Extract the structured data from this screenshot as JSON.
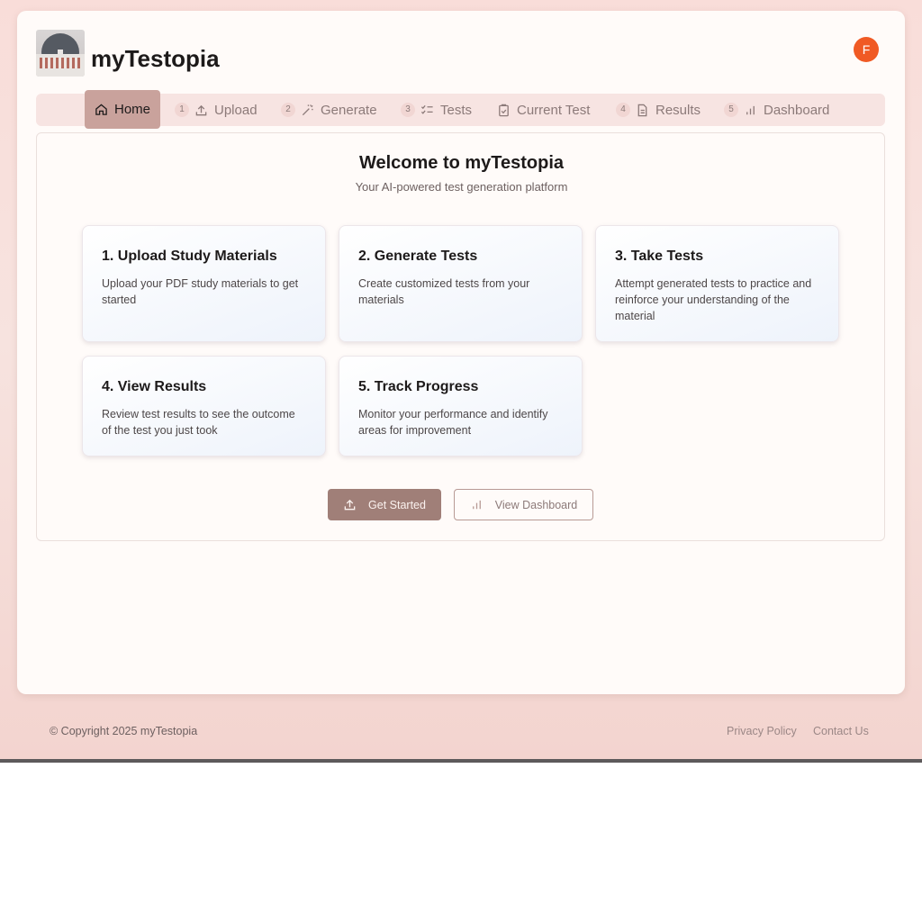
{
  "app": {
    "brand": "myTestopia",
    "avatar_initial": "F"
  },
  "nav": {
    "items": [
      {
        "label": "Home",
        "icon": "home-icon",
        "step": ""
      },
      {
        "label": "Upload",
        "icon": "upload-icon",
        "step": "1"
      },
      {
        "label": "Generate",
        "icon": "wand-icon",
        "step": "2"
      },
      {
        "label": "Tests",
        "icon": "checklist-icon",
        "step": "3"
      },
      {
        "label": "Current Test",
        "icon": "clipboard-icon",
        "step": ""
      },
      {
        "label": "Results",
        "icon": "document-icon",
        "step": "4"
      },
      {
        "label": "Dashboard",
        "icon": "bar-chart-icon",
        "step": "5"
      }
    ],
    "active": "Home"
  },
  "main": {
    "title": "Welcome to myTestopia",
    "subtitle": "Your AI-powered test generation platform",
    "features": [
      {
        "title": "1. Upload Study Materials",
        "description": "Upload your PDF study materials to get started"
      },
      {
        "title": "2. Generate Tests",
        "description": "Create customized tests from your materials"
      },
      {
        "title": "3. Take Tests",
        "description": "Attempt generated tests to practice and reinforce your understanding of the material"
      },
      {
        "title": "4. View Results",
        "description": "Review test results to see the outcome of the test you just took"
      },
      {
        "title": "5. Track Progress",
        "description": "Monitor your performance and identify areas for improvement"
      }
    ],
    "primary_button": "Get Started",
    "secondary_button": "View Dashboard"
  },
  "footer": {
    "copyright": "© Copyright 2025 myTestopia",
    "links": [
      "Privacy Policy",
      "Contact Us"
    ]
  },
  "colors": {
    "accent": "#a07f78",
    "active_tab": "#c9a29c",
    "avatar": "#f05a24"
  }
}
